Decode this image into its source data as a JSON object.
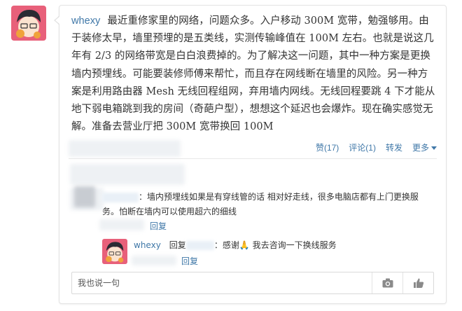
{
  "post": {
    "author": "whexy",
    "body": "最近重修家里的网络，问题众多。入户移动 300M 宽带，勉强够用。由于装修太早，墙里预埋的是五类线，实测传输峰值在 100M 左右。也就是说这几年有 2/3 的网络带宽是白白浪费掉的。为了解决这一问题，其中一种方案是更换墙内预埋线。可能要装修师傅来帮忙，而且存在网线断在墙里的风险。另一种方案是利用路由器 Mesh 无线回程组网，弃用墙内网线。无线回程要跳 4 下才能从地下弱电箱跳到我的房间（奇葩户型），想想这个延迟也会爆炸。现在确实感觉无解。准备去营业厅把 300M 宽带换回 100M",
    "actions": {
      "like": "赞(17)",
      "comment": "评论(1)",
      "repost": "转发",
      "more": "更多"
    }
  },
  "comments": [
    {
      "text": "：墙内预埋线如果是有穿线管的话 相对好走线，很多电脑店都有上门更换服务。怕断在墙内可以使用超六的细线",
      "reply_label": "回复"
    },
    {
      "author": "whexy",
      "reply_prefix": "回复",
      "text": "：感谢🙏  我去咨询一下换线服务",
      "reply_label": "回复"
    }
  ],
  "input": {
    "placeholder": "我也说一句"
  },
  "icons": {
    "camera": "camera-icon",
    "thumbs": "thumbs-up-icon"
  },
  "colors": {
    "link": "#4078a8",
    "border": "#e3e3e3"
  }
}
